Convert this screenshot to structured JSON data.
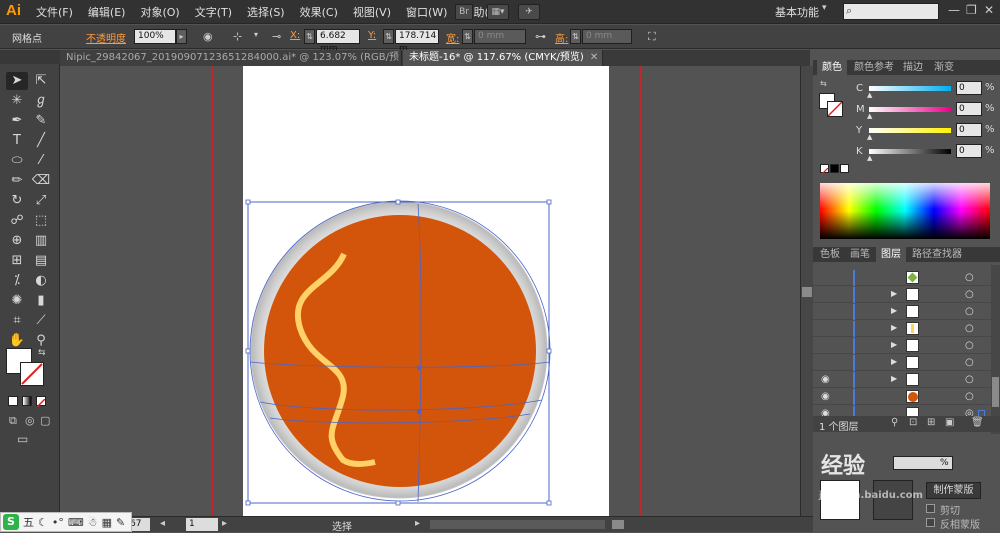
{
  "app": {
    "logo": "Ai",
    "menus": [
      "文件(F)",
      "编辑(E)",
      "对象(O)",
      "文字(T)",
      "选择(S)",
      "效果(C)",
      "视图(V)",
      "窗口(W)",
      "帮助(H)"
    ],
    "workspace": "基本功能",
    "bridge_label": "Br"
  },
  "control_bar": {
    "selection_type": "网格点",
    "opacity_label": "不透明度",
    "opacity_value": "100%",
    "x_label": "X:",
    "x_value": "6.682 mm",
    "y_label": "Y:",
    "y_value": "178.714 m",
    "w_label": "宽:",
    "w_value": "0 mm",
    "h_label": "高:",
    "h_value": "0 mm"
  },
  "tabs": [
    {
      "label": "Nipic_29842067_20190907123651284000.ai* @ 123.07% (RGB/预览)",
      "active": false
    },
    {
      "label": "未标题-16* @ 117.67% (CMYK/预览)",
      "active": true
    }
  ],
  "color_panel": {
    "tabs": [
      "颜色",
      "颜色参考",
      "描边",
      "渐变"
    ],
    "channels": [
      {
        "name": "C",
        "value": "0",
        "unit": "%"
      },
      {
        "name": "M",
        "value": "0",
        "unit": "%"
      },
      {
        "name": "Y",
        "value": "0",
        "unit": "%"
      },
      {
        "name": "K",
        "value": "0",
        "unit": "%"
      }
    ]
  },
  "layers_panel": {
    "tabs": [
      "色板",
      "画笔",
      "图层",
      "路径查找器"
    ],
    "layer_count": "1 个图层",
    "make_mask_button": "制作蒙版",
    "clip_label": "剪切",
    "invert_label": "反相蒙版"
  },
  "status_bar": {
    "zoom": "67",
    "page": "1",
    "status_text": "选择"
  },
  "ime": {
    "items": [
      "五"
    ]
  },
  "watermark": {
    "text": "经验",
    "url": "jingyan.baidu.com"
  },
  "colors": {
    "circle_fill": "#d2550b",
    "wave_stroke": "#ffd166",
    "rim": "#dcdcdc",
    "selection": "#4a64c8",
    "guide": "#c1272d"
  }
}
